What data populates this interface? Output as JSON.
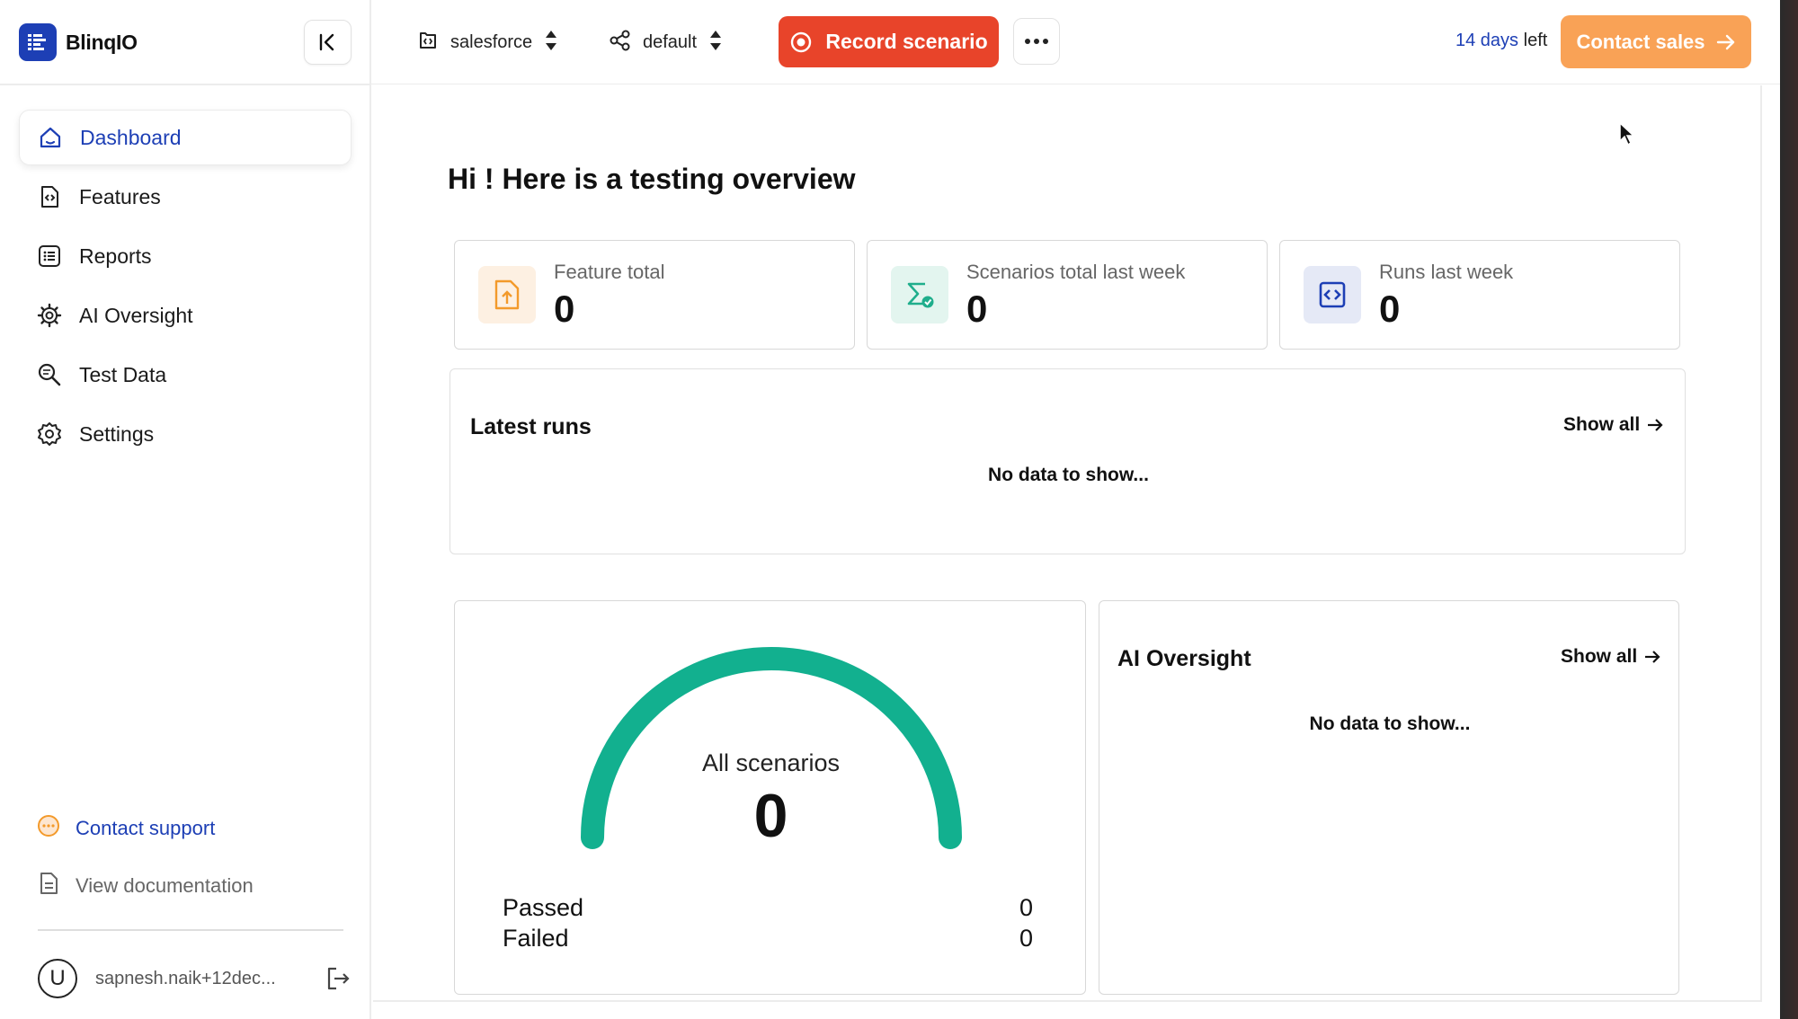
{
  "brand": {
    "name": "BlinqIO"
  },
  "sidebar": {
    "items": [
      {
        "label": "Dashboard",
        "icon": "home-icon",
        "active": true
      },
      {
        "label": "Features",
        "icon": "file-code-icon"
      },
      {
        "label": "Reports",
        "icon": "list-icon"
      },
      {
        "label": "AI Oversight",
        "icon": "ai-gear-icon"
      },
      {
        "label": "Test Data",
        "icon": "search-data-icon"
      },
      {
        "label": "Settings",
        "icon": "gear-icon"
      }
    ],
    "support_label": "Contact support",
    "docs_label": "View documentation",
    "user": {
      "initial": "U",
      "email": "sapnesh.naik+12dec..."
    }
  },
  "topbar": {
    "project": "salesforce",
    "environment": "default",
    "record_label": "Record scenario",
    "trial_days": "14 days",
    "trial_suffix": "left",
    "contact_sales_label": "Contact sales"
  },
  "main": {
    "title": "Hi ! Here is a testing overview",
    "stats": [
      {
        "label": "Feature total",
        "value": "0",
        "icon": "feature-upload-icon",
        "color": "#f39a2b"
      },
      {
        "label": "Scenarios total last week",
        "value": "0",
        "icon": "sigma-check-icon",
        "color": "#1fae8c"
      },
      {
        "label": "Runs last week",
        "value": "0",
        "icon": "code-icon",
        "color": "#1d3fb5"
      }
    ],
    "latest_runs": {
      "title": "Latest runs",
      "show_all": "Show all",
      "empty": "No data to show..."
    },
    "gauge": {
      "label": "All scenarios",
      "value": "0",
      "passed_label": "Passed",
      "passed_value": "0",
      "failed_label": "Failed",
      "failed_value": "0"
    },
    "oversight": {
      "title": "AI Oversight",
      "show_all": "Show all",
      "empty": "No data to show..."
    }
  },
  "colors": {
    "brand": "#1d3fb5",
    "record": "#e8442a",
    "contact_sales": "#f9a256",
    "gauge": "#12b08f"
  }
}
